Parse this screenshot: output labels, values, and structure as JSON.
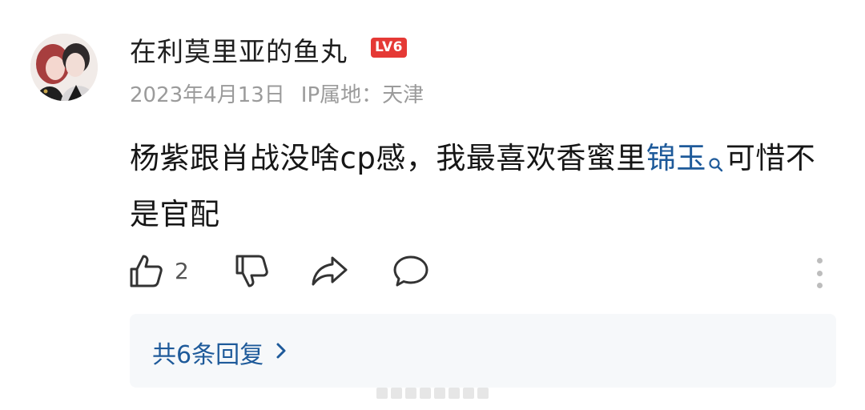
{
  "user": {
    "name": "在利莫里亚的鱼丸",
    "level": "LV6",
    "date": "2023年4月13日",
    "ip_location": "IP属地：天津"
  },
  "comment": {
    "text_before_link": "杨紫跟肖战没啥cp感，我最喜欢香蜜里",
    "topic_link": "锦玉",
    "text_after_link": "可惜不是官配"
  },
  "actions": {
    "like_count": "2"
  },
  "replies": {
    "label": "共6条回复"
  },
  "colors": {
    "link": "#1e5a9a",
    "level_badge": "#e53935",
    "meta_text": "#9b9b9b",
    "reply_panel_bg": "#f6f8fa"
  },
  "icons": [
    "avatar",
    "level-badge",
    "search-icon",
    "thumbs-up-icon",
    "thumbs-down-icon",
    "share-icon",
    "comment-icon",
    "more-icon",
    "chevron-right-icon"
  ]
}
